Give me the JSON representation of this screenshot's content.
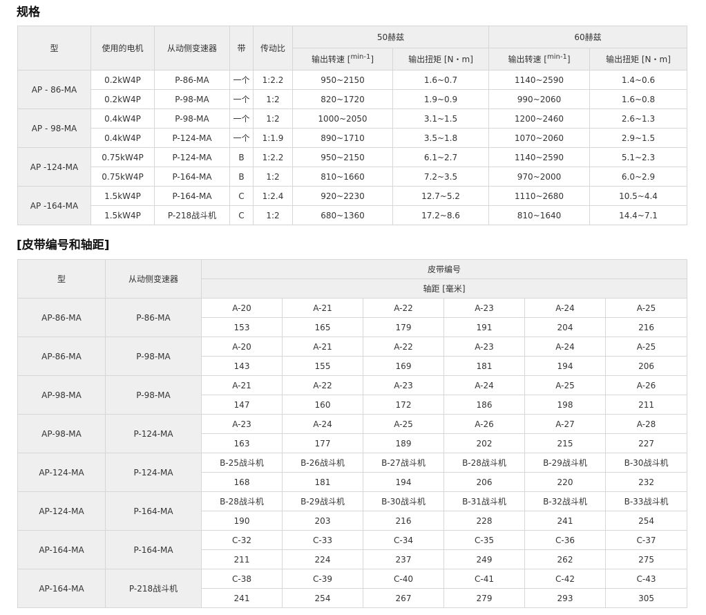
{
  "spec_title": "规格",
  "spec": {
    "headers": {
      "model": "型",
      "motor": "使用的电机",
      "reducer": "从动侧变速器",
      "belt": "带",
      "ratio": "传动比",
      "hz50": "50赫兹",
      "hz60": "60赫兹",
      "speed_prefix": "输出转速 [",
      "speed_unit": "min-1",
      "speed_suffix": "]",
      "torque": "输出扭矩 [N・m]"
    },
    "groups": [
      {
        "model": "AP - 86-MA",
        "rows": [
          {
            "motor": "0.2kW4P",
            "reducer": "P-86-MA",
            "belt": "一个",
            "ratio": "1:2.2",
            "speed50": "950~2150",
            "torque50": "1.6~0.7",
            "speed60": "1140~2590",
            "torque60": "1.4~0.6"
          },
          {
            "motor": "0.2kW4P",
            "reducer": "P-98-MA",
            "belt": "一个",
            "ratio": "1:2",
            "speed50": "820~1720",
            "torque50": "1.9~0.9",
            "speed60": "990~2060",
            "torque60": "1.6~0.8"
          }
        ]
      },
      {
        "model": "AP - 98-MA",
        "rows": [
          {
            "motor": "0.4kW4P",
            "reducer": "P-98-MA",
            "belt": "一个",
            "ratio": "1:2",
            "speed50": "1000~2050",
            "torque50": "3.1~1.5",
            "speed60": "1200~2460",
            "torque60": "2.6~1.3"
          },
          {
            "motor": "0.4kW4P",
            "reducer": "P-124-MA",
            "belt": "一个",
            "ratio": "1:1.9",
            "speed50": "890~1710",
            "torque50": "3.5~1.8",
            "speed60": "1070~2060",
            "torque60": "2.9~1.5"
          }
        ]
      },
      {
        "model": "AP -124-MA",
        "rows": [
          {
            "motor": "0.75kW4P",
            "reducer": "P-124-MA",
            "belt": "B",
            "ratio": "1:2.2",
            "speed50": "950~2150",
            "torque50": "6.1~2.7",
            "speed60": "1140~2590",
            "torque60": "5.1~2.3"
          },
          {
            "motor": "0.75kW4P",
            "reducer": "P-164-MA",
            "belt": "B",
            "ratio": "1:2",
            "speed50": "810~1660",
            "torque50": "7.2~3.5",
            "speed60": "970~2000",
            "torque60": "6.0~2.9"
          }
        ]
      },
      {
        "model": "AP -164-MA",
        "rows": [
          {
            "motor": "1.5kW4P",
            "reducer": "P-164-MA",
            "belt": "C",
            "ratio": "1:2.4",
            "speed50": "920~2230",
            "torque50": "12.7~5.2",
            "speed60": "1110~2680",
            "torque60": "10.5~4.4"
          },
          {
            "motor": "1.5kW4P",
            "reducer": "P-218战斗机",
            "belt": "C",
            "ratio": "1:2",
            "speed50": "680~1360",
            "torque50": "17.2~8.6",
            "speed60": "810~1640",
            "torque60": "14.4~7.1"
          }
        ]
      }
    ]
  },
  "belt_title": "[皮带编号和轴距]",
  "belt": {
    "headers": {
      "model": "型",
      "reducer": "从动侧变速器",
      "belt_no": "皮带编号",
      "distance": "轴距 [毫米]"
    },
    "rows": [
      {
        "model": "AP-86-MA",
        "reducer": "P-86-MA",
        "belts": [
          "A-20",
          "A-21",
          "A-22",
          "A-23",
          "A-24",
          "A-25"
        ],
        "dists": [
          "153",
          "165",
          "179",
          "191",
          "204",
          "216"
        ]
      },
      {
        "model": "AP-86-MA",
        "reducer": "P-98-MA",
        "belts": [
          "A-20",
          "A-21",
          "A-22",
          "A-23",
          "A-24",
          "A-25"
        ],
        "dists": [
          "143",
          "155",
          "169",
          "181",
          "194",
          "206"
        ]
      },
      {
        "model": "AP-98-MA",
        "reducer": "P-98-MA",
        "belts": [
          "A-21",
          "A-22",
          "A-23",
          "A-24",
          "A-25",
          "A-26"
        ],
        "dists": [
          "147",
          "160",
          "172",
          "186",
          "198",
          "211"
        ]
      },
      {
        "model": "AP-98-MA",
        "reducer": "P-124-MA",
        "belts": [
          "A-23",
          "A-24",
          "A-25",
          "A-26",
          "A-27",
          "A-28"
        ],
        "dists": [
          "163",
          "177",
          "189",
          "202",
          "215",
          "227"
        ]
      },
      {
        "model": "AP-124-MA",
        "reducer": "P-124-MA",
        "belts": [
          "B-25战斗机",
          "B-26战斗机",
          "B-27战斗机",
          "B-28战斗机",
          "B-29战斗机",
          "B-30战斗机"
        ],
        "dists": [
          "168",
          "181",
          "194",
          "206",
          "220",
          "232"
        ]
      },
      {
        "model": "AP-124-MA",
        "reducer": "P-164-MA",
        "belts": [
          "B-28战斗机",
          "B-29战斗机",
          "B-30战斗机",
          "B-31战斗机",
          "B-32战斗机",
          "B-33战斗机"
        ],
        "dists": [
          "190",
          "203",
          "216",
          "228",
          "241",
          "254"
        ]
      },
      {
        "model": "AP-164-MA",
        "reducer": "P-164-MA",
        "belts": [
          "C-32",
          "C-33",
          "C-34",
          "C-35",
          "C-36",
          "C-37"
        ],
        "dists": [
          "211",
          "224",
          "237",
          "249",
          "262",
          "275"
        ]
      },
      {
        "model": "AP-164-MA",
        "reducer": "P-218战斗机",
        "belts": [
          "C-38",
          "C-39",
          "C-40",
          "C-41",
          "C-42",
          "C-43"
        ],
        "dists": [
          "241",
          "254",
          "267",
          "279",
          "293",
          "305"
        ]
      }
    ]
  },
  "colors": {
    "header_bg": "#efefef",
    "border": "#d6d6d6"
  }
}
